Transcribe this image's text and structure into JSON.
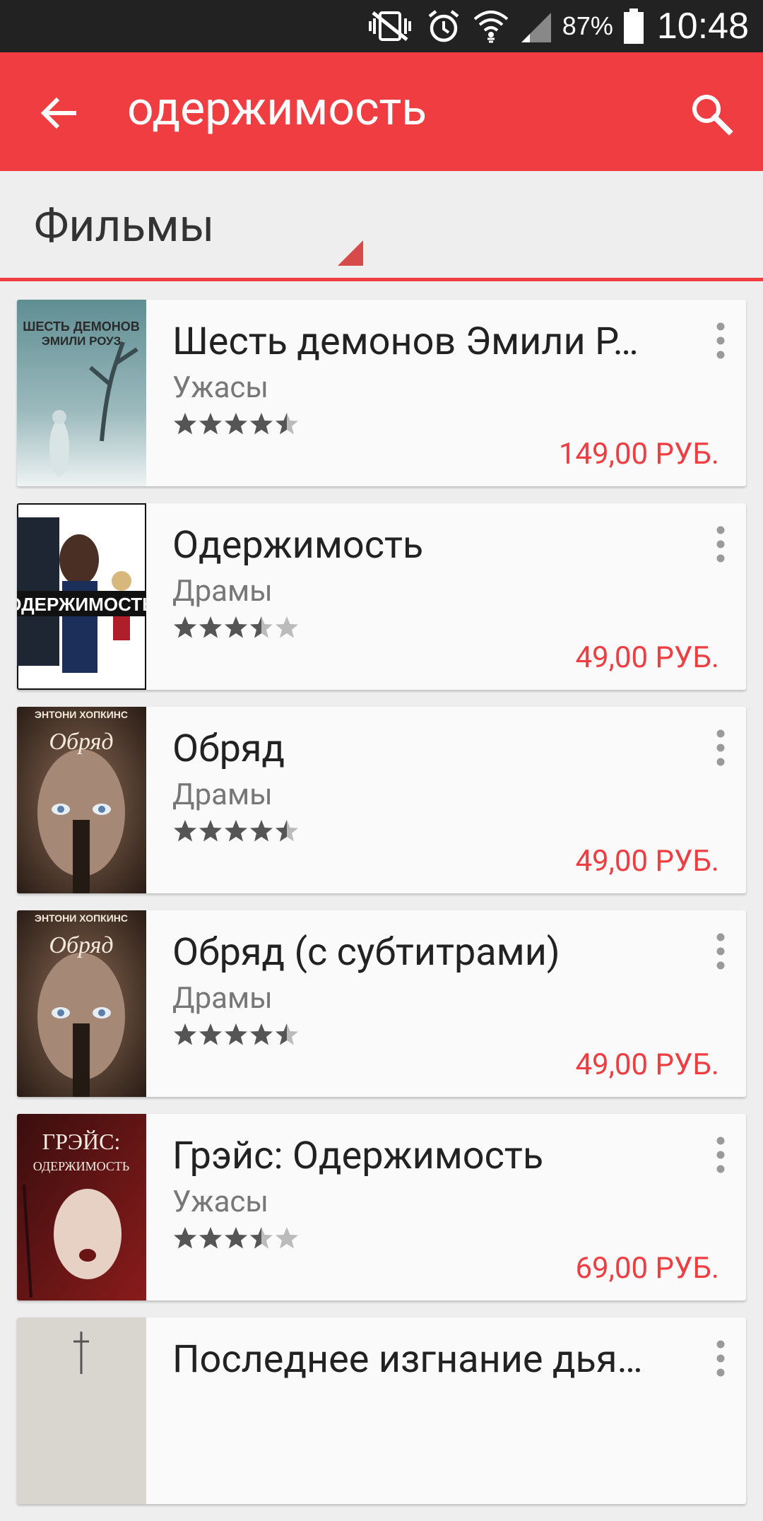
{
  "status_bar": {
    "battery": "87%",
    "time": "10:48",
    "icons": [
      "vibrate-mute-icon",
      "alarm-icon",
      "wifi-icon",
      "signal-icon",
      "battery-icon"
    ]
  },
  "app_bar": {
    "title": "одержимость",
    "back_icon": "arrow-back-icon",
    "search_icon": "search-icon",
    "color": "#ef3d41"
  },
  "category": {
    "label": "Фильмы"
  },
  "results": [
    {
      "title": "Шесть демонов Эмили Р…",
      "genre": "Ужасы",
      "rating": 4.5,
      "price": "149,00 РУБ.",
      "poster": {
        "top": "ШЕСТЬ ДЕМОНОВ",
        "bottom": "ЭМИЛИ РОУЗ",
        "style": "mist"
      }
    },
    {
      "title": "Одержимость",
      "genre": "Драмы",
      "rating": 3.5,
      "price": "49,00 РУБ.",
      "poster": {
        "top": "ОДЕРЖИМОСТЬ",
        "bottom": "",
        "style": "white"
      }
    },
    {
      "title": "Обряд",
      "genre": "Драмы",
      "rating": 4.5,
      "price": "49,00 РУБ.",
      "poster": {
        "top": "ЭНТОНИ ХОПКИНС",
        "bottom": "Обряд",
        "style": "dark"
      }
    },
    {
      "title": "Обряд (с субтитрами)",
      "genre": "Драмы",
      "rating": 4.5,
      "price": "49,00 РУБ.",
      "poster": {
        "top": "ЭНТОНИ ХОПКИНС",
        "bottom": "Обряд",
        "style": "dark"
      }
    },
    {
      "title": "Грэйс: Одержимость",
      "genre": "Ужасы",
      "rating": 3.5,
      "price": "69,00 РУБ.",
      "poster": {
        "top": "ГРЭЙС:",
        "bottom": "ОДЕРЖИМОСТЬ",
        "style": "red"
      }
    },
    {
      "title": "Последнее изгнание дья…",
      "genre": "",
      "rating": 0,
      "price": "",
      "poster": {
        "top": "",
        "bottom": "",
        "style": "pale"
      }
    }
  ]
}
